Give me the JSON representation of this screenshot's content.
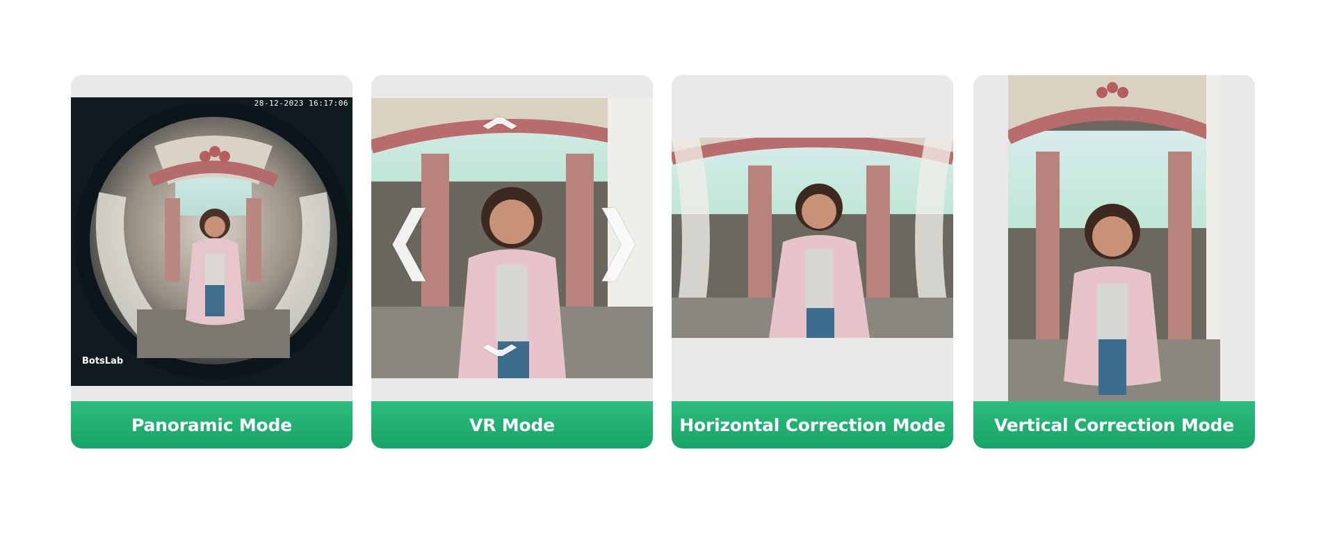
{
  "cards": [
    {
      "title": "Panoramic Mode",
      "timestamp": "28-12-2023 16:17:06",
      "brand": "BotsLab"
    },
    {
      "title": "VR Mode",
      "arrows": {
        "up": "⌃",
        "down": "⌄",
        "left": "❮",
        "right": "❯"
      }
    },
    {
      "title": "Horizontal Correction Mode"
    },
    {
      "title": "Vertical Correction Mode"
    }
  ],
  "colors": {
    "card_bg": "#e9e9e9",
    "label_green_top": "#2dbd7e",
    "label_green_bottom": "#18a366",
    "label_text": "#ffffff"
  },
  "icons": {
    "vr_up": "chevron-up-icon",
    "vr_down": "chevron-down-icon",
    "vr_left": "chevron-left-icon",
    "vr_right": "chevron-right-icon"
  }
}
